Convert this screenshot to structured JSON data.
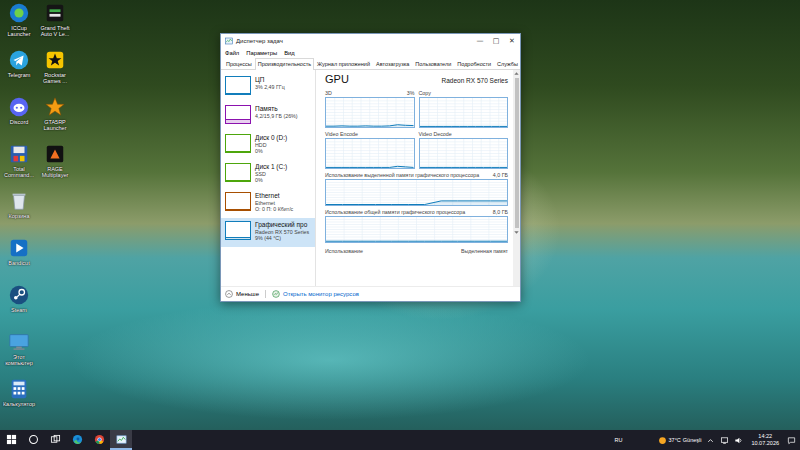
{
  "desktop_icons": [
    {
      "label": "ICCup Launcher",
      "kind": "iccup"
    },
    {
      "label": "Telegram",
      "kind": "telegram"
    },
    {
      "label": "Discord",
      "kind": "discord"
    },
    {
      "label": "Total Command...",
      "kind": "totalcmd"
    },
    {
      "label": "Корзина",
      "kind": "recycle"
    },
    {
      "label": "Bandicut",
      "kind": "bandicut"
    },
    {
      "label": "Steam",
      "kind": "steam"
    },
    {
      "label": "Этот компьютер",
      "kind": "thispc"
    },
    {
      "label": "Калькулятор",
      "kind": "calc"
    },
    {
      "label": "Grand Theft Auto V Le...",
      "kind": "gta"
    },
    {
      "label": "Rockstar Games ...",
      "kind": "rockstar"
    },
    {
      "label": "GTA5RP Launcher",
      "kind": "gta5rp"
    },
    {
      "label": "RAGE Multiplayer",
      "kind": "rage"
    }
  ],
  "window": {
    "title": "Диспетчер задач",
    "controls": [
      "—",
      "□",
      "✕"
    ]
  },
  "menu": [
    "Файл",
    "Параметры",
    "Вид"
  ],
  "tabs": [
    {
      "label": "Процессы",
      "selected": false
    },
    {
      "label": "Производительность",
      "selected": true
    },
    {
      "label": "Журнал приложений",
      "selected": false
    },
    {
      "label": "Автозагрузка",
      "selected": false
    },
    {
      "label": "Пользователи",
      "selected": false
    },
    {
      "label": "Подробности",
      "selected": false
    },
    {
      "label": "Службы",
      "selected": false
    }
  ],
  "sidebar": {
    "items": [
      {
        "name": "ЦП",
        "lines": [
          "3% 2,49 ГГц"
        ],
        "color": "#117dbb",
        "level": 0.03,
        "selected": false
      },
      {
        "name": "Память",
        "lines": [
          "4,2/15,9 ГБ (26%)"
        ],
        "color": "#8b12ae",
        "level": 0.26,
        "selected": false
      },
      {
        "name": "Диск 0 (D:)",
        "lines": [
          "HDD",
          "0%"
        ],
        "color": "#4da60c",
        "level": 0,
        "selected": false
      },
      {
        "name": "Диск 1 (C:)",
        "lines": [
          "SSD",
          "0%"
        ],
        "color": "#4da60c",
        "level": 0,
        "selected": false
      },
      {
        "name": "Ethernet",
        "lines": [
          "Ethernet",
          "О: 0 П: 0 Кбит/с"
        ],
        "color": "#a74f01",
        "level": 0,
        "selected": false
      },
      {
        "name": "Графический про",
        "lines": [
          "Radeon RX 570 Series",
          "9% (44 °C)"
        ],
        "color": "#117dbb",
        "level": 0.09,
        "selected": true
      }
    ]
  },
  "detail": {
    "title": "GPU",
    "device": "Radeon RX 570 Series",
    "engines": [
      {
        "label": "3D",
        "reading": "3%",
        "values": [
          1,
          1,
          2,
          1,
          1,
          2,
          1,
          1,
          2,
          6,
          4,
          3
        ]
      },
      {
        "label": "Copy",
        "values": [
          0,
          0,
          0,
          0,
          0,
          0,
          0,
          0,
          0,
          0,
          0,
          0
        ]
      },
      {
        "label": "Video Encode",
        "values": [
          0,
          0,
          0,
          0,
          0,
          0,
          0,
          0,
          0,
          4,
          2,
          0
        ]
      },
      {
        "label": "Video Decode",
        "values": [
          0,
          0,
          0,
          0,
          0,
          0,
          0,
          0,
          0,
          0,
          0,
          0
        ]
      }
    ],
    "memory": [
      {
        "label": "Использование выделенной памяти графического процессора",
        "max": "4,0 ГБ",
        "scale": 4,
        "values": [
          0,
          0,
          0,
          0,
          0,
          0,
          0,
          0.6,
          0.6,
          0.6,
          0.6,
          0.6
        ]
      },
      {
        "label": "Использование общей памяти графического процессора",
        "max": "8,0 ГБ",
        "scale": 8,
        "values": [
          0.1,
          0.1,
          0.1,
          0.1,
          0.1,
          0.1,
          0.1,
          0.1,
          0.1,
          0.1,
          0.1,
          0.1
        ]
      }
    ],
    "bottom": {
      "left": "Использование",
      "right": "Выделенная памят"
    }
  },
  "footer": {
    "less": "Меньше",
    "link": "Открыть монитор ресурсов"
  },
  "taskbar": {
    "apps": [
      {
        "kind": "edge",
        "running": false
      },
      {
        "kind": "chrome",
        "running": false
      },
      {
        "kind": "taskmgr",
        "running": true
      }
    ],
    "lang": "RU",
    "weather": {
      "temp": "37°C",
      "text": "Güneşli"
    },
    "tray": [
      {
        "kind": "chevron"
      },
      {
        "kind": "network"
      },
      {
        "kind": "volume"
      }
    ],
    "time": "14:22",
    "date": "10.07.2026"
  }
}
